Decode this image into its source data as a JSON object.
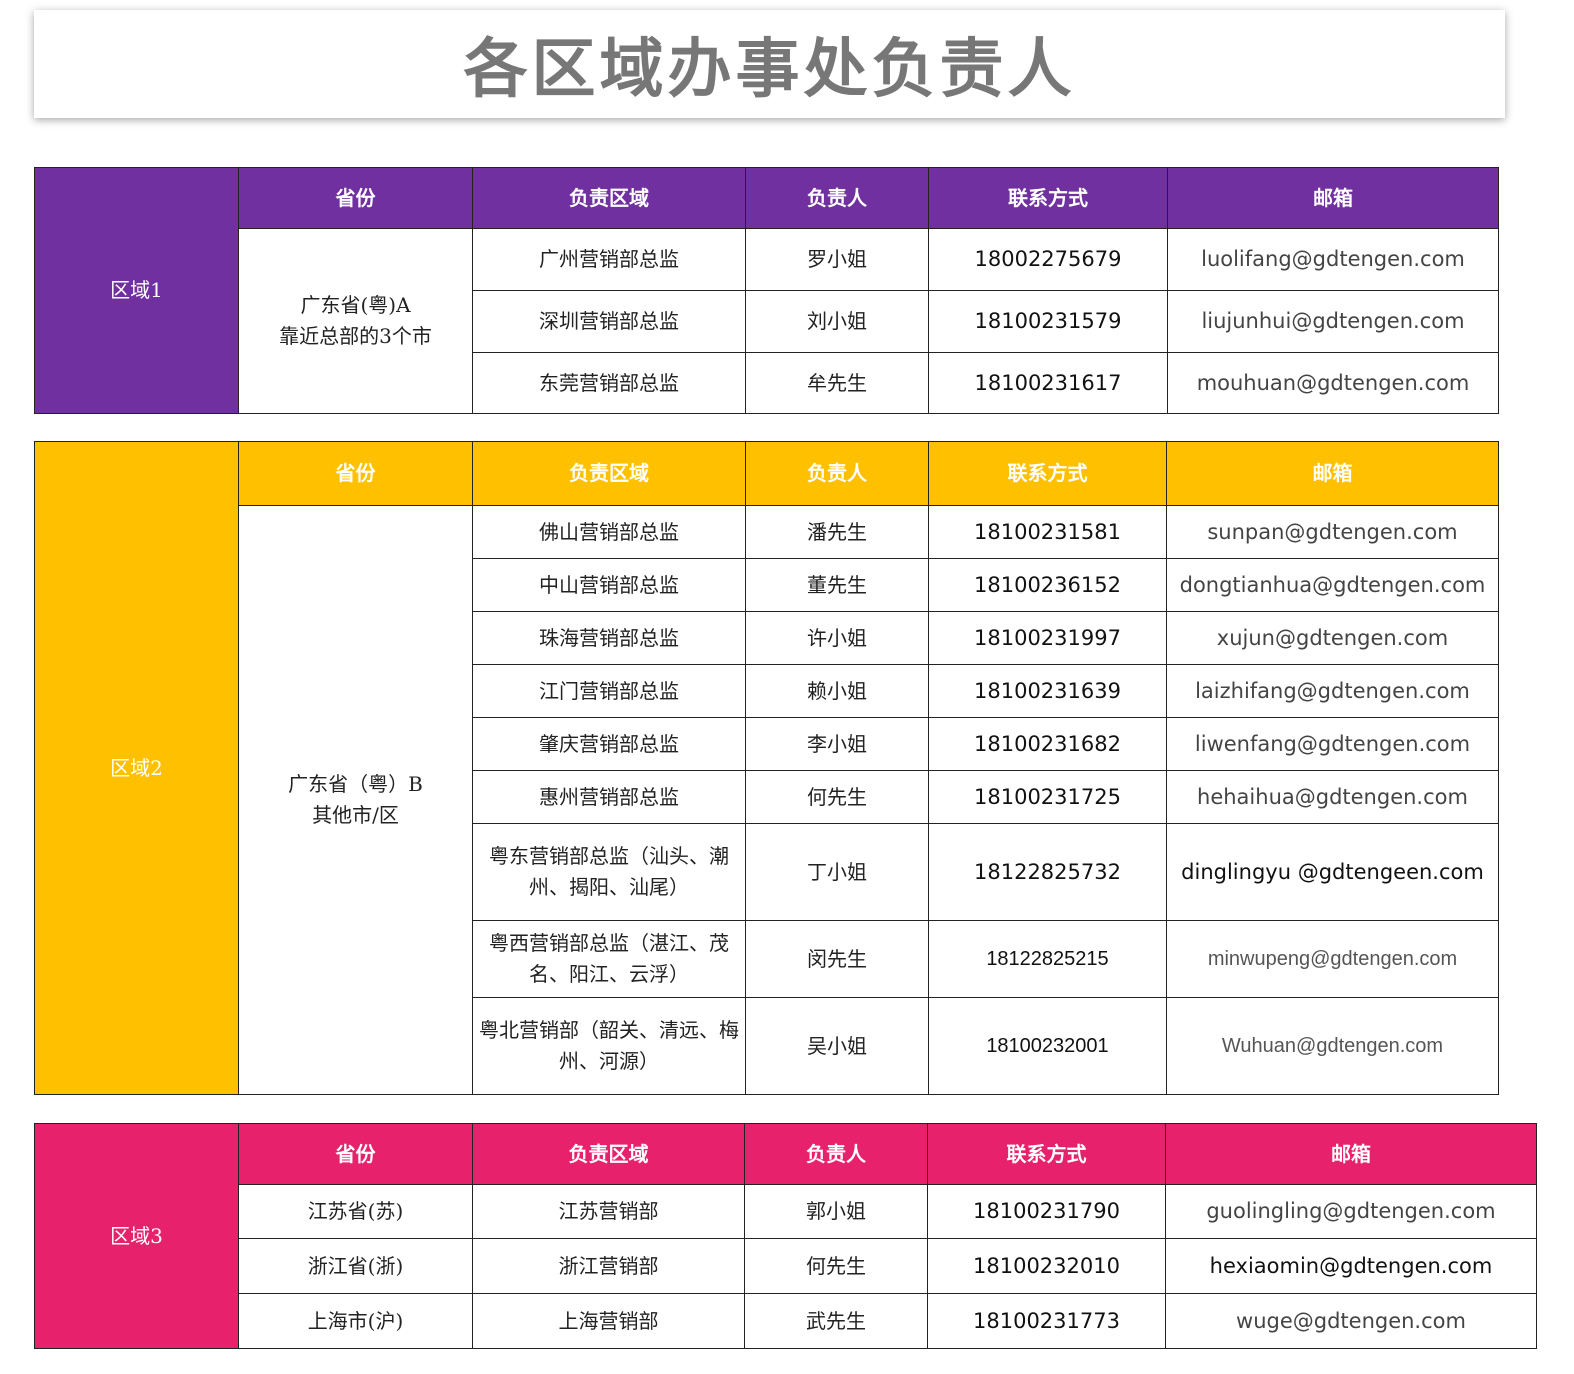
{
  "title": "各区域办事处负责人",
  "headers": {
    "province": "省份",
    "area": "负责区域",
    "person": "负责人",
    "contact": "联系方式",
    "email": "邮箱"
  },
  "region1": {
    "name": "区域1",
    "province_line1": "广东省(粤)A",
    "province_line2": "靠近总部的3个市",
    "rows": [
      {
        "area": "广州营销部总监",
        "person": "罗小姐",
        "phone": "18002275679",
        "email": "luolifang@gdtengen.com"
      },
      {
        "area": "深圳营销部总监",
        "person": "刘小姐",
        "phone": "18100231579",
        "email": "liujunhui@gdtengen.com"
      },
      {
        "area": "东莞营销部总监",
        "person": "牟先生",
        "phone": "18100231617",
        "email": "mouhuan@gdtengen.com"
      }
    ]
  },
  "region2": {
    "name": "区域2",
    "province_line1": "广东省（粤）B",
    "province_line2": "其他市/区",
    "rows": [
      {
        "area": "佛山营销部总监",
        "person": "潘先生",
        "phone": "18100231581",
        "email": "sunpan@gdtengen.com"
      },
      {
        "area": "中山营销部总监",
        "person": "董先生",
        "phone": "18100236152",
        "email": "dongtianhua@gdtengen.com"
      },
      {
        "area": "珠海营销部总监",
        "person": "许小姐",
        "phone": "18100231997",
        "email": "xujun@gdtengen.com"
      },
      {
        "area": "江门营销部总监",
        "person": "赖小姐",
        "phone": "18100231639",
        "email": "laizhifang@gdtengen.com"
      },
      {
        "area": "肇庆营销部总监",
        "person": "李小姐",
        "phone": "18100231682",
        "email": "liwenfang@gdtengen.com"
      },
      {
        "area": "惠州营销部总监",
        "person": "何先生",
        "phone": "18100231725",
        "email": "hehaihua@gdtengen.com"
      },
      {
        "area": "粤东营销部总监（汕头、潮州、揭阳、汕尾）",
        "person": "丁小姐",
        "phone": "18122825732",
        "email": "dinglingyu @gdtengeen.com"
      },
      {
        "area": "粤西营销部总监（湛江、茂名、阳江、云浮）",
        "person": "闵先生",
        "phone": "18122825215",
        "email": "minwupeng@gdtengen.com"
      },
      {
        "area": "粤北营销部（韶关、清远、梅州、河源）",
        "person": "吴小姐",
        "phone": "18100232001",
        "email": "Wuhuan@gdtengen.com"
      }
    ]
  },
  "region3": {
    "name": "区域3",
    "rows": [
      {
        "province": "江苏省(苏)",
        "area": "江苏营销部",
        "person": "郭小姐",
        "phone": "18100231790",
        "email": "guolingling@gdtengen.com"
      },
      {
        "province": "浙江省(浙)",
        "area": "浙江营销部",
        "person": "何先生",
        "phone": "18100232010",
        "email": "hexiaomin@gdtengen.com"
      },
      {
        "province": "上海市(沪)",
        "area": "上海营销部",
        "person": "武先生",
        "phone": "18100231773",
        "email": "wuge@gdtengen.com"
      }
    ]
  },
  "colors": {
    "region1": "#7030A0",
    "region2": "#FFC000",
    "region3": "#E8216C",
    "title": "#777777"
  }
}
